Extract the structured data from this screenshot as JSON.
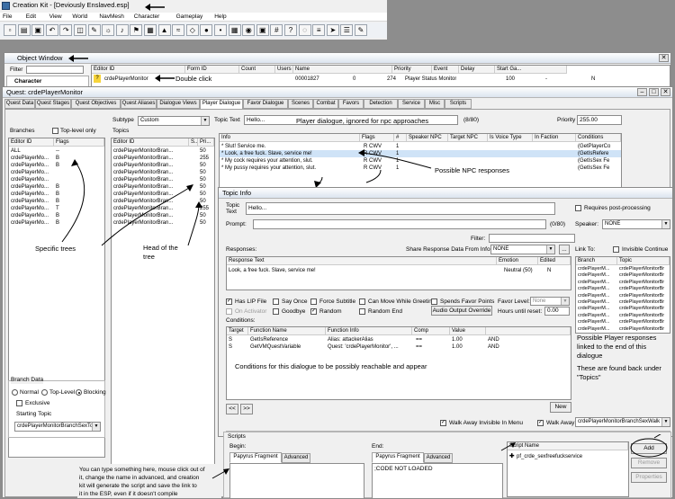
{
  "app": {
    "title": "Creation Kit - [Deviously Enslaved.esp]",
    "menu": [
      "File",
      "Edit",
      "View",
      "World",
      "NavMesh",
      "Character",
      "Gameplay",
      "Help"
    ]
  },
  "toolbar": {
    "icons": [
      "new-icon",
      "open-icon",
      "save-icon",
      "undo-icon",
      "redo-icon",
      "render-icon",
      "brush-icon",
      "light-icon",
      "sound-icon",
      "marker-icon",
      "cube-icon",
      "terrain-icon",
      "water-icon",
      "navmesh-icon",
      "sphere-icon",
      "dot-icon",
      "grid-icon",
      "camera-icon",
      "lock-icon",
      "snap-icon",
      "help-icon",
      "bubble-icon",
      "stairs-icon",
      "arrow-icon",
      "list-icon",
      "scripts-icon"
    ]
  },
  "object_window": {
    "title": "Object Window",
    "filter_label": "Filter",
    "tree_item": "Character"
  },
  "object_list": {
    "columns": [
      "Editor ID",
      "Form ID",
      "Count",
      "Users",
      "Name",
      "Priority",
      "Event",
      "Delay",
      "Start Ga..."
    ],
    "row": {
      "flag": "?",
      "editor_id": "crdePlayerMonitor",
      "form_id": "00001827",
      "count": "0",
      "users": "274",
      "name": "Player Status Monitor",
      "priority": "100",
      "event": "-",
      "delay": "",
      "start_game": "N"
    }
  },
  "quest": {
    "title": "Quest: crdePlayerMonitor",
    "tabs": [
      "Quest Data",
      "Quest Stages",
      "Quest Objectives",
      "Quest Aliases",
      "Dialogue Views",
      "Player Dialogue",
      "Favor Dialogue",
      "Scenes",
      "Combat",
      "Favors",
      "Detection",
      "Service",
      "Misc",
      "Scripts"
    ],
    "subtype_label": "Subtype",
    "subtype_value": "Custom",
    "topic_text_label": "Topic Text",
    "topic_text_value": "Hello...",
    "topic_text_count": "(8/80)",
    "priority_label": "Priority",
    "priority_value": "255.00",
    "branches_label": "Branches",
    "top_level_only": "Top-level only",
    "branches_columns": [
      "Editor ID",
      "Flags"
    ],
    "branches": [
      {
        "id": "ALL",
        "flags": "--"
      },
      {
        "id": "crdePlayerMo...",
        "flags": "B"
      },
      {
        "id": "crdePlayerMo...",
        "flags": "B"
      },
      {
        "id": "crdePlayerMo...",
        "flags": ""
      },
      {
        "id": "crdePlayerMo...",
        "flags": ""
      },
      {
        "id": "crdePlayerMo...",
        "flags": "B"
      },
      {
        "id": "crdePlayerMo...",
        "flags": "B"
      },
      {
        "id": "crdePlayerMo...",
        "flags": "B"
      },
      {
        "id": "crdePlayerMo...",
        "flags": "T"
      },
      {
        "id": "crdePlayerMo...",
        "flags": "B"
      },
      {
        "id": "crdePlayerMo...",
        "flags": "B"
      }
    ],
    "topics_label": "Topics",
    "topics_columns": [
      "Editor ID",
      "S...",
      "Pri..."
    ],
    "topics": [
      {
        "id": "crdePlayerMonitorBran...",
        "p": "50"
      },
      {
        "id": "crdePlayerMonitorBran...",
        "p": "255"
      },
      {
        "id": "crdePlayerMonitorBran...",
        "p": "50"
      },
      {
        "id": "crdePlayerMonitorBran...",
        "p": "50"
      },
      {
        "id": "crdePlayerMonitorBran...",
        "p": "50"
      },
      {
        "id": "crdePlayerMonitorBran...",
        "p": "50"
      },
      {
        "id": "crdePlayerMonitorBran...",
        "p": "50"
      },
      {
        "id": "crdePlayerMonitorBran...",
        "p": "50"
      },
      {
        "id": "crdePlayerMonitorBran...",
        "p": "255"
      },
      {
        "id": "crdePlayerMonitorBran...",
        "p": "50"
      },
      {
        "id": "crdePlayerMonitorBran...",
        "p": "50"
      }
    ],
    "info_columns": [
      "Info",
      "Flags",
      "#",
      "Speaker NPC",
      "Target NPC",
      "Is Voice Type",
      "In Faction",
      "Conditions"
    ],
    "info": [
      {
        "text": "* Slut! Service me.",
        "flags": "R  CWV",
        "n": "1",
        "cond": "(GetPlayerCo"
      },
      {
        "text": "* Look, a free fuck. Slave, service me!",
        "flags": "R  CWV",
        "n": "1",
        "cond": "(GetIsRefere"
      },
      {
        "text": "* My cock requires your attention, slut.",
        "flags": "R  CWV",
        "n": "1",
        "cond": "(GetIsSex Fe"
      },
      {
        "text": "* My pussy requires your attention, slut.",
        "flags": "R  CWV",
        "n": "1",
        "cond": "(GetIsSex Fe"
      }
    ],
    "branch_data_label": "Branch Data",
    "radio_normal": "Normal",
    "radio_toplevel": "Top-Level",
    "radio_blocking": "Blocking",
    "exclusive": "Exclusive",
    "starting_topic_label": "Starting Topic",
    "starting_topic_value": "crdePlayerMonitorBranchSexTo..."
  },
  "topic_info": {
    "title": "Topic Info",
    "topic_label": "Topic",
    "text_label": "Text",
    "topic_value": "Hello...",
    "requires_post": "Requires post-processing",
    "prompt_label": "Prompt:",
    "prompt_count": "(0/80)",
    "speaker_label": "Speaker:",
    "speaker_value": "NONE",
    "filter_label": "Filter:",
    "responses_label": "Responses:",
    "share_label": "Share Response Data From Info:",
    "share_value": "NONE",
    "share_btn": "...",
    "link_to_label": "Link To:",
    "invisible_continue": "Invisible Continue",
    "resp_columns": [
      "Response Text",
      "Emotion",
      "Edited"
    ],
    "resp_row": {
      "text": "Look, a free fuck. Slave, service me!",
      "emotion": "Neutral (50)",
      "edited": "N"
    },
    "link_columns": [
      "Branch",
      "Topic"
    ],
    "links": [
      {
        "b": "crdePlayerM...",
        "t": "crdePlayerMonitorBr"
      },
      {
        "b": "crdePlayerM...",
        "t": "crdePlayerMonitorBr"
      },
      {
        "b": "crdePlayerM...",
        "t": "crdePlayerMonitorBr"
      },
      {
        "b": "crdePlayerM...",
        "t": "crdePlayerMonitorBr"
      },
      {
        "b": "crdePlayerM...",
        "t": "crdePlayerMonitorBr"
      },
      {
        "b": "crdePlayerM...",
        "t": "crdePlayerMonitorBr"
      },
      {
        "b": "crdePlayerM...",
        "t": "crdePlayerMonitorBr"
      },
      {
        "b": "crdePlayerM...",
        "t": "crdePlayerMonitorBr"
      },
      {
        "b": "crdePlayerM...",
        "t": "crdePlayerMonitorBr"
      },
      {
        "b": "crdePlayerM...",
        "t": "crdePlayerMonitorBr"
      }
    ],
    "chk_has_lip": "Has LIP File",
    "chk_say_once": "Say Once",
    "chk_force_subtitle": "Force Subtitle",
    "chk_can_move": "Can Move While Greeting",
    "chk_spends_favor": "Spends Favor Points",
    "favor_level_label": "Favor Level:",
    "favor_level_value": "None",
    "chk_on_activator": "On Activator",
    "chk_goodbye": "Goodbye",
    "chk_random": "Random",
    "chk_random_end": "Random End",
    "audio_override": "Audio Output Override",
    "hours_label": "Hours until reset:",
    "hours_value": "0.00",
    "conditions_label": "Conditions:",
    "cond_columns": [
      "Target",
      "Function Name",
      "Function Info",
      "Comp",
      "Value",
      ""
    ],
    "conditions": [
      {
        "target": "S",
        "fn": "GetIsReference",
        "info": "Alias: attackerAlias",
        "comp": "==",
        "value": "1.00",
        "op": "AND"
      },
      {
        "target": "S",
        "fn": "GetVMQuestVariable",
        "info": "Quest: 'crdePlayerMonitor', ...",
        "comp": "==",
        "value": "1.00",
        "op": "AND"
      }
    ],
    "nav_prev": "<<",
    "nav_next": ">>",
    "new_btn": "New",
    "walk_invisible": "Walk Away Invisible In Menu",
    "walk_away": "Walk Away:",
    "walk_away_value": "crdePlayerMonitorBranchSexWalk",
    "scripts_label": "Scripts",
    "begin_label": "Begin:",
    "end_label": "End:",
    "papyrus_tab": "Papyrus Fragment",
    "advanced_tab": "Advanced",
    "end_text": ";CODE NOT LOADED",
    "script_name_col": "Script Name",
    "script_item": "pf_crde_sexfreefuckservice",
    "add_btn": "Add",
    "remove_btn": "Remove",
    "properties_btn": "Properties"
  },
  "annotations": {
    "double_click": "Double click",
    "player_dialogue": "Player dialogue, ignored for npc approaches",
    "possible_npc": "Possible NPC responses",
    "specific_trees": "Specific trees",
    "head_of": "Head of the",
    "tree": "tree",
    "conditions_note": "Conditions for this dialogue to be possibly reachable and appear",
    "possible_player": [
      "Possible Player responses",
      "linked to the end of this",
      "dialogue"
    ],
    "found_back": [
      "These are found back under",
      "\"Topics\""
    ],
    "fragment_note": [
      "You can type something here, mouse click out of",
      "it, change the name in advanced, and creation",
      "kit will generate the script and save the link to",
      "it in the ESP, even if it doesn't compile"
    ]
  },
  "colors": {
    "accent_yellow": "#f7d43b",
    "selection": "#cfe3f7",
    "titlebar": "#dbe4ef"
  }
}
